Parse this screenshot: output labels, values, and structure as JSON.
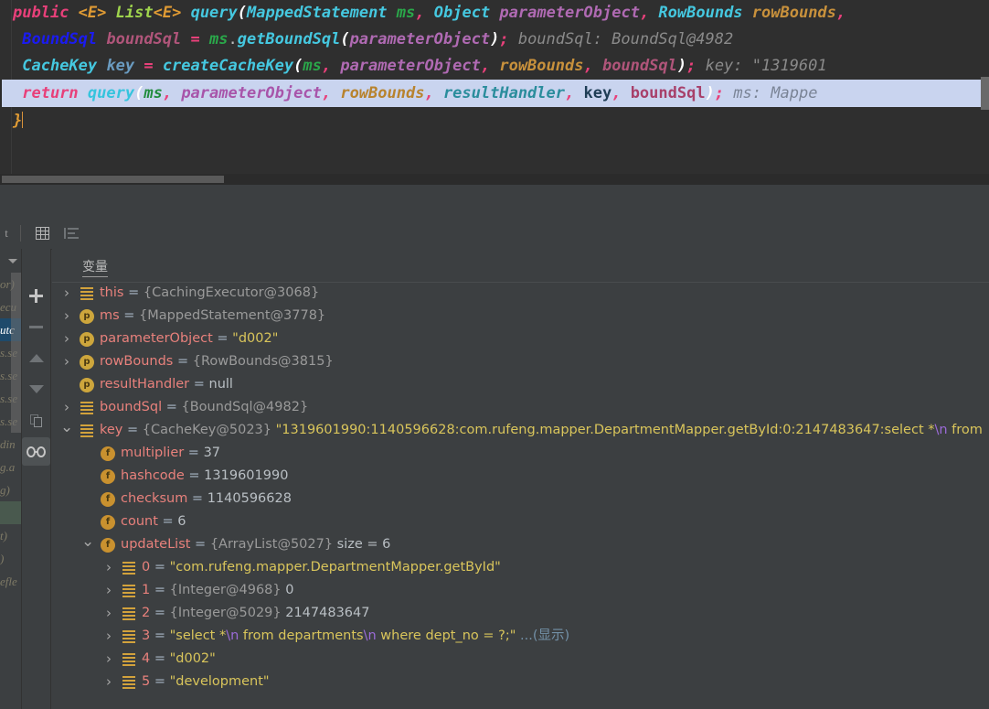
{
  "editor": {
    "lines": [
      {
        "id": "line-signature",
        "tokens": [
          {
            "t": "public ",
            "c": "kw"
          },
          {
            "t": "<",
            "c": "generic"
          },
          {
            "t": "E",
            "c": "generic"
          },
          {
            "t": "> ",
            "c": "generic"
          },
          {
            "t": "List",
            "c": "type"
          },
          {
            "t": "<",
            "c": "generic"
          },
          {
            "t": "E",
            "c": "generic"
          },
          {
            "t": "> ",
            "c": "generic"
          },
          {
            "t": "query",
            "c": "meth"
          },
          {
            "t": "(",
            "c": "paren"
          },
          {
            "t": "MappedStatement ",
            "c": "cls"
          },
          {
            "t": "ms",
            "c": "param"
          },
          {
            "t": ", ",
            "c": "punc"
          },
          {
            "t": "Object ",
            "c": "cls"
          },
          {
            "t": "parameterObject",
            "c": "pobj"
          },
          {
            "t": ", ",
            "c": "punc"
          },
          {
            "t": "RowBounds ",
            "c": "cls"
          },
          {
            "t": "rowBounds",
            "c": "rb"
          },
          {
            "t": ",",
            "c": "punc"
          }
        ]
      },
      {
        "id": "line-boundsql",
        "tokens": [
          {
            "t": "  ",
            "c": "plain"
          },
          {
            "t": "BoundSql ",
            "c": "cls-b"
          },
          {
            "t": "boundSql",
            "c": "bsql"
          },
          {
            "t": " = ",
            "c": "punc"
          },
          {
            "t": "ms",
            "c": "param"
          },
          {
            "t": ".",
            "c": "plain"
          },
          {
            "t": "getBoundSql",
            "c": "meth"
          },
          {
            "t": "(",
            "c": "paren"
          },
          {
            "t": "parameterObject",
            "c": "pobj"
          },
          {
            "t": ")",
            "c": "paren"
          },
          {
            "t": ";",
            "c": "punc"
          },
          {
            "t": "   boundSql: BoundSql@4982",
            "c": "hint"
          }
        ]
      },
      {
        "id": "line-cachekey",
        "tokens": [
          {
            "t": "  ",
            "c": "plain"
          },
          {
            "t": "CacheKey ",
            "c": "cls"
          },
          {
            "t": "key",
            "c": "var"
          },
          {
            "t": " = ",
            "c": "punc"
          },
          {
            "t": "createCacheKey",
            "c": "meth"
          },
          {
            "t": "(",
            "c": "paren"
          },
          {
            "t": "ms",
            "c": "param"
          },
          {
            "t": ", ",
            "c": "punc"
          },
          {
            "t": "parameterObject",
            "c": "pobj"
          },
          {
            "t": ", ",
            "c": "punc"
          },
          {
            "t": "rowBounds",
            "c": "rb"
          },
          {
            "t": ", ",
            "c": "punc"
          },
          {
            "t": "boundSql",
            "c": "bsql"
          },
          {
            "t": ")",
            "c": "paren"
          },
          {
            "t": ";",
            "c": "punc"
          },
          {
            "t": "  key: \"1319601",
            "c": "hint"
          }
        ]
      },
      {
        "id": "line-return",
        "highlighted": true,
        "tokens": [
          {
            "t": "  ",
            "c": "plain"
          },
          {
            "t": "return ",
            "c": "kw"
          },
          {
            "t": "query",
            "c": "meth"
          },
          {
            "t": "(",
            "c": "paren"
          },
          {
            "t": "ms",
            "c": "param"
          },
          {
            "t": ", ",
            "c": "punc"
          },
          {
            "t": "parameterObject",
            "c": "pobj"
          },
          {
            "t": ", ",
            "c": "punc"
          },
          {
            "t": "rowBounds",
            "c": "rb"
          },
          {
            "t": ", ",
            "c": "punc"
          },
          {
            "t": "resultHandler",
            "c": "rh"
          },
          {
            "t": ", ",
            "c": "punc"
          },
          {
            "t": "key",
            "c": "key"
          },
          {
            "t": ", ",
            "c": "punc"
          },
          {
            "t": "boundSql",
            "c": "bsql"
          },
          {
            "t": ")",
            "c": "paren"
          },
          {
            "t": ";",
            "c": "punc"
          },
          {
            "t": "   ms: Mappe",
            "c": "hint"
          }
        ]
      },
      {
        "id": "line-close-brace",
        "tokens": [
          {
            "t": "}",
            "c": "brace"
          }
        ]
      }
    ]
  },
  "debugger": {
    "toolbar": {
      "partial_label": "t",
      "buttons": [
        {
          "name": "table-view-button",
          "icon": "table-icon"
        },
        {
          "name": "sort-values-button",
          "icon": "sort-lines-icon"
        }
      ]
    },
    "frames": {
      "rows": [
        {
          "text": "or)",
          "style": "lib"
        },
        {
          "text": "ecu",
          "style": "lib"
        },
        {
          "text": "utc",
          "style": "sel"
        },
        {
          "text": "s.se",
          "style": "lib"
        },
        {
          "text": "s.se",
          "style": "lib"
        },
        {
          "text": "s.se",
          "style": "lib"
        },
        {
          "text": "s.se",
          "style": "lib"
        },
        {
          "text": "din",
          "style": "lib"
        },
        {
          "text": "g.a",
          "style": "lib"
        },
        {
          "text": "g)",
          "style": "lib"
        },
        {
          "text": "",
          "style": "green"
        },
        {
          "text": "t)",
          "style": "lib"
        },
        {
          "text": ")",
          "style": "lib"
        },
        {
          "text": "efle",
          "style": "lib"
        }
      ]
    },
    "actions": [
      {
        "name": "add-watch-button",
        "icon": "plus-icon",
        "active": false
      },
      {
        "name": "remove-watch-button",
        "icon": "minus-icon",
        "active": false
      },
      {
        "name": "move-up-button",
        "icon": "arrow-up-icon",
        "active": false
      },
      {
        "name": "move-down-button",
        "icon": "arrow-down-icon",
        "active": false
      },
      {
        "name": "copy-value-button",
        "icon": "copy-icon",
        "active": false
      },
      {
        "name": "inspect-watches-button",
        "icon": "glasses-icon",
        "active": true
      }
    ],
    "variables_pane": {
      "header_label": "变量",
      "tree": [
        {
          "indent": 0,
          "arrow": "collapsed",
          "icon": "local-variable-icon",
          "icon_glyph": "",
          "name": "this",
          "eq": " = ",
          "parts": [
            {
              "t": "{CachingExecutor@3068}",
              "c": "ref"
            }
          ]
        },
        {
          "indent": 0,
          "arrow": "collapsed",
          "icon": "parameter-icon",
          "icon_glyph": "p",
          "name": "ms",
          "eq": " = ",
          "parts": [
            {
              "t": "{MappedStatement@3778}",
              "c": "ref"
            }
          ]
        },
        {
          "indent": 0,
          "arrow": "collapsed",
          "icon": "parameter-icon",
          "icon_glyph": "p",
          "name": "parameterObject",
          "eq": " = ",
          "parts": [
            {
              "t": "\"d002\"",
              "c": "str"
            }
          ]
        },
        {
          "indent": 0,
          "arrow": "collapsed",
          "icon": "parameter-icon",
          "icon_glyph": "p",
          "name": "rowBounds",
          "eq": " = ",
          "parts": [
            {
              "t": "{RowBounds@3815}",
              "c": "ref"
            }
          ]
        },
        {
          "indent": 0,
          "arrow": "none",
          "icon": "parameter-icon",
          "icon_glyph": "p",
          "name": "resultHandler",
          "eq": " = ",
          "parts": [
            {
              "t": "null",
              "c": "null"
            }
          ]
        },
        {
          "indent": 0,
          "arrow": "collapsed",
          "icon": "local-variable-icon",
          "icon_glyph": "",
          "name": "boundSql",
          "eq": " = ",
          "parts": [
            {
              "t": "{BoundSql@4982}",
              "c": "ref"
            }
          ]
        },
        {
          "indent": 0,
          "arrow": "expanded",
          "icon": "local-variable-icon",
          "icon_glyph": "",
          "name": "key",
          "eq": " = ",
          "parts": [
            {
              "t": "{CacheKey@5023} ",
              "c": "ref"
            },
            {
              "t": "\"1319601990:1140596628:com.rufeng.mapper.DepartmentMapper.getById:0:2147483647:select *",
              "c": "str"
            },
            {
              "t": "\\n",
              "c": "nl"
            },
            {
              "t": "     from",
              "c": "str"
            }
          ]
        },
        {
          "indent": 1,
          "arrow": "none",
          "icon": "field-icon",
          "icon_glyph": "f",
          "name": "multiplier",
          "eq": " = ",
          "parts": [
            {
              "t": "37",
              "c": "num"
            }
          ]
        },
        {
          "indent": 1,
          "arrow": "none",
          "icon": "field-icon",
          "icon_glyph": "f",
          "name": "hashcode",
          "eq": " = ",
          "parts": [
            {
              "t": "1319601990",
              "c": "num"
            }
          ]
        },
        {
          "indent": 1,
          "arrow": "none",
          "icon": "field-icon",
          "icon_glyph": "f",
          "name": "checksum",
          "eq": " = ",
          "parts": [
            {
              "t": "1140596628",
              "c": "num"
            }
          ]
        },
        {
          "indent": 1,
          "arrow": "none",
          "icon": "field-icon",
          "icon_glyph": "f",
          "name": "count",
          "eq": " = ",
          "parts": [
            {
              "t": "6",
              "c": "num"
            }
          ]
        },
        {
          "indent": 1,
          "arrow": "expanded",
          "icon": "field-icon",
          "icon_glyph": "f",
          "name": "updateList",
          "eq": " = ",
          "parts": [
            {
              "t": "{ArrayList@5027}",
              "c": "ref"
            },
            {
              "t": "  size = 6",
              "c": "size"
            }
          ]
        },
        {
          "indent": 2,
          "arrow": "collapsed",
          "icon": "local-variable-icon",
          "icon_glyph": "",
          "name": "0",
          "eq": " = ",
          "parts": [
            {
              "t": "\"com.rufeng.mapper.DepartmentMapper.getById\"",
              "c": "str"
            }
          ]
        },
        {
          "indent": 2,
          "arrow": "collapsed",
          "icon": "local-variable-icon",
          "icon_glyph": "",
          "name": "1",
          "eq": " = ",
          "parts": [
            {
              "t": "{Integer@4968} ",
              "c": "ref"
            },
            {
              "t": "0",
              "c": "num"
            }
          ]
        },
        {
          "indent": 2,
          "arrow": "collapsed",
          "icon": "local-variable-icon",
          "icon_glyph": "",
          "name": "2",
          "eq": " = ",
          "parts": [
            {
              "t": "{Integer@5029} ",
              "c": "ref"
            },
            {
              "t": "2147483647",
              "c": "num"
            }
          ]
        },
        {
          "indent": 2,
          "arrow": "collapsed",
          "icon": "local-variable-icon",
          "icon_glyph": "",
          "name": "3",
          "eq": " = ",
          "parts": [
            {
              "t": "\"select *",
              "c": "str"
            },
            {
              "t": "\\n",
              "c": "nl"
            },
            {
              "t": "      from departments",
              "c": "str"
            },
            {
              "t": "\\n",
              "c": "nl"
            },
            {
              "t": "      where dept_no = ?;\"",
              "c": "str"
            },
            {
              "t": " ...(显示)",
              "c": "link"
            }
          ]
        },
        {
          "indent": 2,
          "arrow": "collapsed",
          "icon": "local-variable-icon",
          "icon_glyph": "",
          "name": "4",
          "eq": " = ",
          "parts": [
            {
              "t": "\"d002\"",
              "c": "str"
            }
          ]
        },
        {
          "indent": 2,
          "arrow": "collapsed",
          "icon": "local-variable-icon",
          "icon_glyph": "",
          "name": "5",
          "eq": " = ",
          "parts": [
            {
              "t": "\"development\"",
              "c": "str"
            }
          ]
        }
      ]
    }
  }
}
